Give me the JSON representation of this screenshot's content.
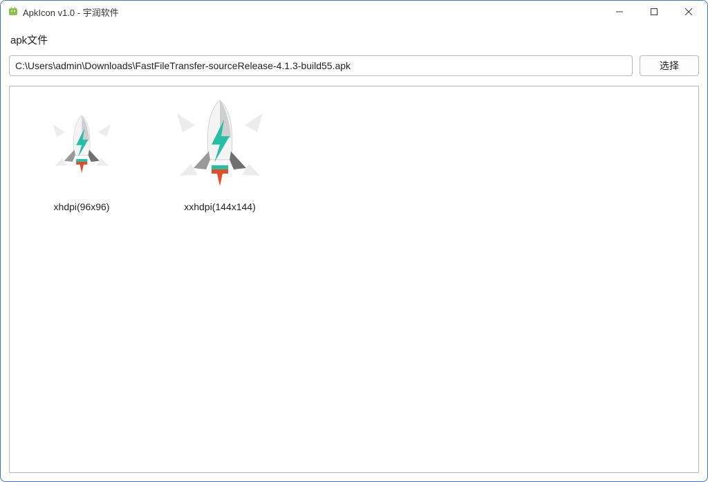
{
  "window": {
    "title": "ApkIcon v1.0 - 宇润软件"
  },
  "toolbar": {
    "file_label": "apk文件",
    "path_value": "C:\\Users\\admin\\Downloads\\FastFileTransfer-sourceRelease-4.1.3-build55.apk",
    "browse_label": "选择"
  },
  "icons": [
    {
      "label": "xhdpi(96x96)",
      "scale": 0.67
    },
    {
      "label": "xxhdpi(144x144)",
      "scale": 1.0
    }
  ]
}
